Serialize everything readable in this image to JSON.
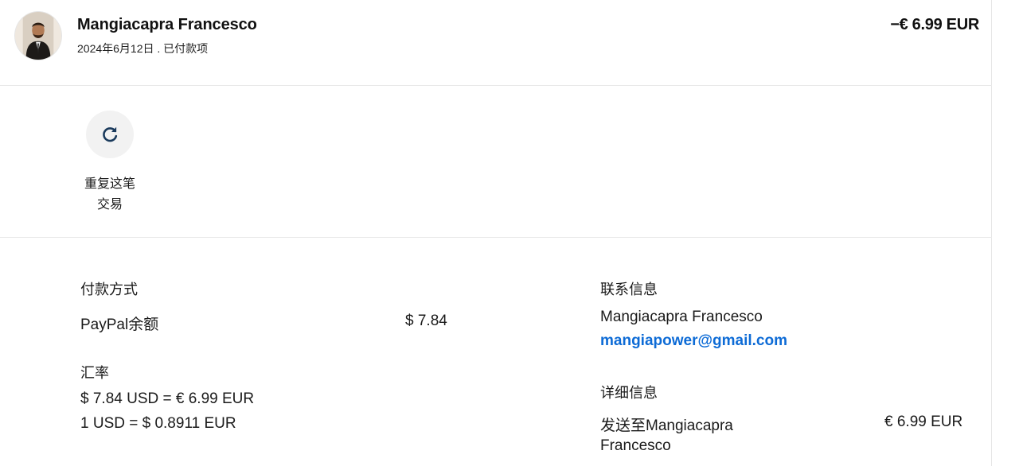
{
  "transaction": {
    "name": "Mangiacapra Francesco",
    "subtitle": "2024年6月12日 . 已付款项",
    "amount": "−€ 6.99 EUR"
  },
  "actions": {
    "repeat_line1": "重复这笔",
    "repeat_line2": "交易",
    "repeat_icon": "refresh-icon"
  },
  "payment": {
    "title": "付款方式",
    "method": "PayPal余额",
    "method_amount": "$ 7.84"
  },
  "exchange": {
    "title": "汇率",
    "line1": "$ 7.84 USD = € 6.99 EUR",
    "line2": "1 USD = $ 0.8911 EUR"
  },
  "contact": {
    "title": "联系信息",
    "name": "Mangiacapra Francesco",
    "email": "mangiapower@gmail.com"
  },
  "details": {
    "title": "详细信息",
    "sent_to_line1": "发送至Mangiacapra",
    "sent_to_line2": "Francesco",
    "amount": "€ 6.99 EUR"
  },
  "colors": {
    "link": "#0d6bd6",
    "divider": "#e9e9e9",
    "action_bg": "#f2f2f2"
  }
}
